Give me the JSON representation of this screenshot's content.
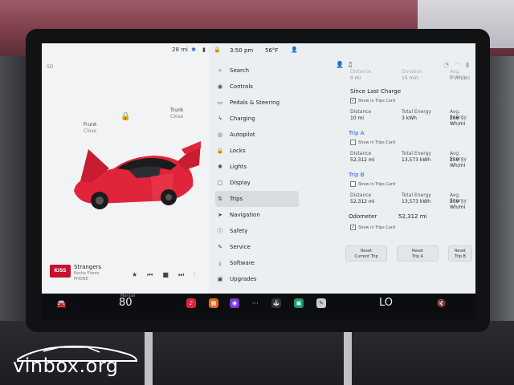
{
  "status": {
    "range": "28 mi",
    "time": "3:50 pm",
    "temperature": "56°F"
  },
  "car": {
    "frunk_label": "Frunk",
    "frunk_sub": "Close",
    "trunk_label": "Trunk",
    "trunk_sub": "Close",
    "sd_label": "SD"
  },
  "media": {
    "station": "KISS",
    "song": "Strangers",
    "artist": "Kesha Flores",
    "extra": "PHONE"
  },
  "menu": {
    "items": [
      {
        "label": "Search",
        "icon": "search-icon"
      },
      {
        "label": "Controls",
        "icon": "toggle-icon"
      },
      {
        "label": "Pedals & Steering",
        "icon": "car-icon"
      },
      {
        "label": "Charging",
        "icon": "bolt-icon"
      },
      {
        "label": "Autopilot",
        "icon": "steering-wheel-icon"
      },
      {
        "label": "Locks",
        "icon": "lock-icon"
      },
      {
        "label": "Lights",
        "icon": "light-icon"
      },
      {
        "label": "Display",
        "icon": "display-icon"
      },
      {
        "label": "Trips",
        "icon": "trips-icon"
      },
      {
        "label": "Navigation",
        "icon": "navigation-icon"
      },
      {
        "label": "Safety",
        "icon": "safety-icon"
      },
      {
        "label": "Service",
        "icon": "wrench-icon"
      },
      {
        "label": "Software",
        "icon": "download-icon"
      },
      {
        "label": "Upgrades",
        "icon": "bag-icon"
      }
    ],
    "active_index": 8
  },
  "trips": {
    "top_row": {
      "distance_label": "Distance",
      "distance_value": "0 mi",
      "duration_label": "Duration",
      "duration_value": "15 min",
      "avg_energy_label": "Avg. Energy",
      "avg_energy_value": "0 Wh/mi"
    },
    "since_last_charge": {
      "title": "Since Last Charge",
      "show_in_card": "Show in Trips Card",
      "checked": true,
      "distance_label": "Distance",
      "distance_value": "10 mi",
      "total_energy_label": "Total Energy",
      "total_energy_value": "3 kWh",
      "avg_energy_label": "Avg. Energy",
      "avg_energy_value": "288 Wh/mi"
    },
    "trip_a": {
      "title": "Trip A",
      "show_in_card": "Show in Trips Card",
      "checked": false,
      "distance_label": "Distance",
      "distance_value": "52,312 mi",
      "total_energy_label": "Total Energy",
      "total_energy_value": "13,573 kWh",
      "avg_energy_label": "Avg. Energy",
      "avg_energy_value": "259 Wh/mi"
    },
    "trip_b": {
      "title": "Trip B",
      "show_in_card": "Show in Trips Card",
      "checked": false,
      "distance_label": "Distance",
      "distance_value": "52,312 mi",
      "total_energy_label": "Total Energy",
      "total_energy_value": "13,573 kWh",
      "avg_energy_label": "Avg. Energy",
      "avg_energy_value": "259 Wh/mi"
    },
    "odometer": {
      "label": "Odometer",
      "value": "52,312 mi",
      "show_in_card": "Show in Trips Card",
      "checked": true
    },
    "buttons": {
      "reset_current_1": "Reset",
      "reset_current_2": "Current Trip",
      "reset_a_1": "Reset",
      "reset_a_2": "Trip A",
      "reset_b_1": "Reset",
      "reset_b_2": "Trip B"
    }
  },
  "dock": {
    "driver_temp_label": "Manual",
    "driver_temp": "80",
    "passenger_temp": "LO"
  },
  "watermark": {
    "text": "vinbox.org"
  },
  "colors": {
    "accent_blue": "#2a5bd7",
    "car_red": "#e0243a",
    "screen_bg": "#eceff1"
  }
}
